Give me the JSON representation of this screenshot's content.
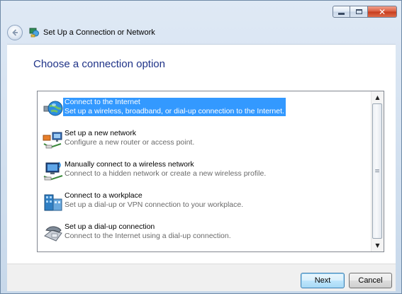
{
  "window": {
    "title": "Set Up a Connection or Network",
    "controls": {
      "minimize": "",
      "maximize": "",
      "close": "✕"
    }
  },
  "page": {
    "title": "Choose a connection option"
  },
  "options": [
    {
      "label": "Connect to the Internet",
      "description": "Set up a wireless, broadband, or dial-up connection to the Internet.",
      "icon": "globe-network-icon",
      "selected": true
    },
    {
      "label": "Set up a new network",
      "description": "Configure a new router or access point.",
      "icon": "new-network-icon",
      "selected": false
    },
    {
      "label": "Manually connect to a wireless network",
      "description": "Connect to a hidden network or create a new wireless profile.",
      "icon": "wireless-network-icon",
      "selected": false
    },
    {
      "label": "Connect to a workplace",
      "description": "Set up a dial-up or VPN connection to your workplace.",
      "icon": "workplace-icon",
      "selected": false
    },
    {
      "label": "Set up a dial-up connection",
      "description": "Connect to the Internet using a dial-up connection.",
      "icon": "dialup-phone-icon",
      "selected": false
    }
  ],
  "scrollbar": {
    "up": "▲",
    "down": "▼",
    "grip": "≡"
  },
  "footer": {
    "next_label": "Next",
    "cancel_label": "Cancel"
  },
  "colors": {
    "selection": "#3399ff",
    "title_blue": "#1e3287",
    "description_gray": "#6a6a6a"
  }
}
